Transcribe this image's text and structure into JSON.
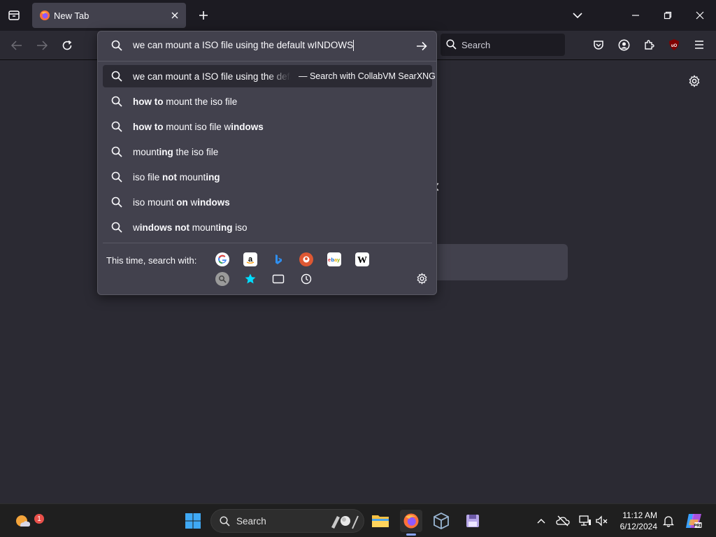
{
  "tab": {
    "title": "New Tab"
  },
  "urlbar": {
    "value": "we can mount a ISO file using the default wINDOWS"
  },
  "toolbar_search": {
    "placeholder": "Search"
  },
  "suggestions": {
    "first": {
      "text": "we can mount a ISO file using the default wINDOWS",
      "action": "— Search with CollabVM SearXNG"
    },
    "items": [
      {
        "parts": [
          {
            "b": true,
            "t": "how to"
          },
          {
            "b": false,
            "t": " mount the iso file"
          }
        ]
      },
      {
        "parts": [
          {
            "b": true,
            "t": "how to"
          },
          {
            "b": false,
            "t": " mount iso file "
          },
          {
            "b": false,
            "t": "w"
          },
          {
            "b": true,
            "t": "indows"
          }
        ]
      },
      {
        "parts": [
          {
            "b": false,
            "t": "mount"
          },
          {
            "b": true,
            "t": "ing"
          },
          {
            "b": false,
            "t": " the iso file"
          }
        ]
      },
      {
        "parts": [
          {
            "b": false,
            "t": "iso file "
          },
          {
            "b": true,
            "t": "not"
          },
          {
            "b": false,
            "t": " mount"
          },
          {
            "b": true,
            "t": "ing"
          }
        ]
      },
      {
        "parts": [
          {
            "b": false,
            "t": "iso mount "
          },
          {
            "b": true,
            "t": "on"
          },
          {
            "b": false,
            "t": " w"
          },
          {
            "b": true,
            "t": "indows"
          }
        ]
      },
      {
        "parts": [
          {
            "b": false,
            "t": "w"
          },
          {
            "b": true,
            "t": "indows not"
          },
          {
            "b": false,
            "t": " mount"
          },
          {
            "b": true,
            "t": "ing"
          },
          {
            "b": false,
            "t": " iso"
          }
        ]
      }
    ]
  },
  "oneoff": {
    "label": "This time, search with:",
    "engines": [
      "google",
      "amazon",
      "bing",
      "duckduckgo",
      "ebay",
      "wikipedia",
      "searxng",
      "bookmarks",
      "tabs",
      "history"
    ]
  },
  "taskbar": {
    "search_placeholder": "Search",
    "time": "11:12 AM",
    "date": "6/12/2024",
    "weather_badge": "1"
  },
  "colors": {
    "accent": "#8aa6ff",
    "panel": "#42414d",
    "page": "#2b2a33"
  }
}
